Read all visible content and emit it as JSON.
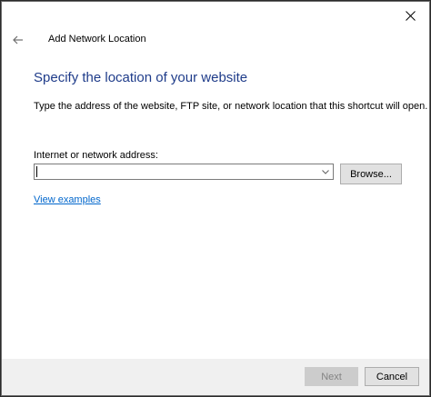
{
  "dialog": {
    "title": "Add Network Location",
    "heading": "Specify the location of your website",
    "description": "Type the address of the website, FTP site, or network location that this shortcut will open."
  },
  "address": {
    "label": "Internet or network address:",
    "value": ""
  },
  "buttons": {
    "browse": "Browse...",
    "next": "Next",
    "cancel": "Cancel"
  },
  "links": {
    "view_examples": "View examples"
  },
  "icons": {
    "close": "close-icon",
    "back": "back-arrow-icon",
    "dropdown": "chevron-down-icon"
  },
  "colors": {
    "heading": "#1f3c8a",
    "link": "#0066cc",
    "disabled_text": "#838383"
  }
}
